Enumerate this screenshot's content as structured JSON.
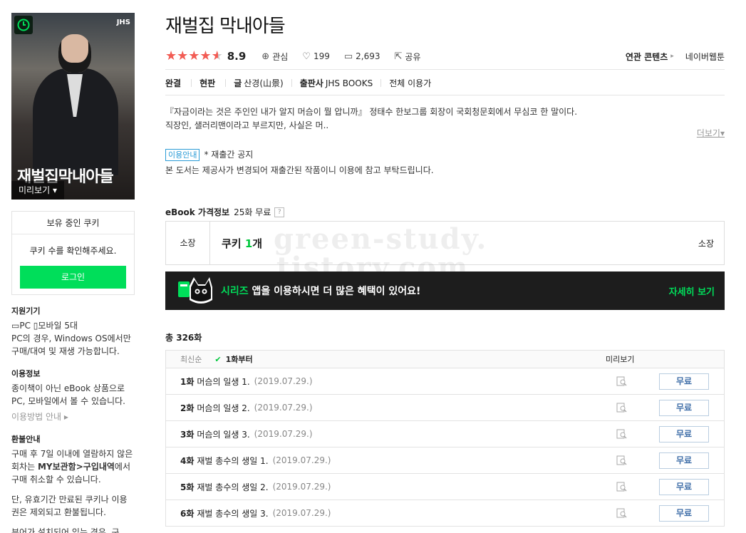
{
  "book": {
    "title": "재벌집 막내아들",
    "cover_title": "재벌집막내아들",
    "cover_publisher_logo": "JHS",
    "preview_label": "미리보기 ▾",
    "rating": "8.9",
    "rating_stars": 4.5,
    "interest_label": "관심",
    "likes": "199",
    "comments": "2,693",
    "share_label": "공유",
    "related_label": "연관 콘텐츠",
    "related_value": "네이버웹툰"
  },
  "attrs": {
    "status": "완결",
    "version": "현판",
    "author_label": "글",
    "author": "산경(山景)",
    "publisher_label": "출판사",
    "publisher": "JHS BOOKS",
    "age": "전체 이용가"
  },
  "description": {
    "line1": "『자금이라는 것은 주인인 내가 알지 머슴이 뭘 압니까』 정태수 한보그룹 회장이 국회청문회에서 무심코 한 말이다.",
    "line2": "직장인, 샐러리맨이라고 부르지만, 사실은 머..",
    "more": "더보기▾"
  },
  "notice": {
    "tag": "이용안내",
    "title": "* 재출간 공지",
    "body": "본 도서는 제공사가 변경되어 재출간된 작품이니 이용에 참고 부탁드립니다."
  },
  "price": {
    "heading": "eBook 가격정보",
    "free_count": "25화 무료",
    "help": "?",
    "own_label": "소장",
    "cookie_prefix": "쿠키 ",
    "cookie_num": "1",
    "cookie_suffix": "개",
    "own_right": "소장"
  },
  "watermark": {
    "line1": "green-study.",
    "line2": "tistory.com"
  },
  "banner": {
    "brand": "시리즈",
    "text": " 앱을 이용하시면 더 많은 혜택이 있어요!",
    "detail": "자세히 보기"
  },
  "sidebar": {
    "cookie_head": "보유 중인 쿠키",
    "cookie_msg": "쿠키 수를 확인해주세요.",
    "login": "로그인",
    "device_title": "지원기기",
    "device_pc": "PC",
    "device_mobile": "모바일 5대",
    "device_text": "PC의 경우, Windows OS에서만 구매/대여 및 재생 가능합니다.",
    "usage_title": "이용정보",
    "usage_text": "종이책이 아닌 eBook 상품으로 PC, 모바일에서 볼 수 있습니다.",
    "usage_link": "이용방법 안내 ▸",
    "refund_title": "환불안내",
    "refund_text_1": "구매 후 7일 이내에 열람하지 않은 회차는 ",
    "refund_bold": "MY보관함>구입내역",
    "refund_text_2": "에서 구매 취소할 수 있습니다.",
    "refund_text_3": "단, 유효기간 만료된 쿠키나 이용권은 제외되고 환불됩니다.",
    "refund_text_4": "뷰어가 설치되어 있는 경우, 구"
  },
  "episodes": {
    "total": "총 326화",
    "sort_latest": "최신순",
    "sort_first": "1화부터",
    "preview_col": "미리보기",
    "items": [
      {
        "no": "1화",
        "name": "머슴의 일생 1.",
        "date": "(2019.07.29.)",
        "btn": "무료"
      },
      {
        "no": "2화",
        "name": "머슴의 일생 2.",
        "date": "(2019.07.29.)",
        "btn": "무료"
      },
      {
        "no": "3화",
        "name": "머슴의 일생 3.",
        "date": "(2019.07.29.)",
        "btn": "무료"
      },
      {
        "no": "4화",
        "name": "재벌 총수의 생일 1.",
        "date": "(2019.07.29.)",
        "btn": "무료"
      },
      {
        "no": "5화",
        "name": "재벌 총수의 생일 2.",
        "date": "(2019.07.29.)",
        "btn": "무료"
      },
      {
        "no": "6화",
        "name": "재벌 총수의 생일 3.",
        "date": "(2019.07.29.)",
        "btn": "무료"
      }
    ]
  },
  "colors": {
    "accent_green": "#00de5a",
    "star_red": "#f25c54",
    "free_button_text": "#3f6ea8"
  }
}
